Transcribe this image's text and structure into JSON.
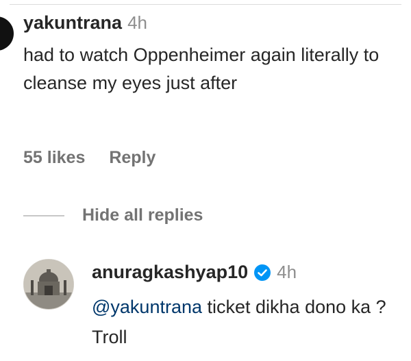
{
  "comment": {
    "username": "yakuntrana",
    "time": "4h",
    "text": "had to watch Oppenheimer again literally to cleanse my eyes just after",
    "likes": "55 likes",
    "reply_label": "Reply"
  },
  "replies_toggle": "Hide all replies",
  "reply": {
    "username": "anuragkashyap10",
    "time": "4h",
    "mention": "@yakuntrana",
    "text": " ticket dikha dono ka ? Troll"
  },
  "colors": {
    "username": "#262626",
    "muted": "#737373",
    "mention": "#00376b",
    "verified": "#0095f6"
  }
}
